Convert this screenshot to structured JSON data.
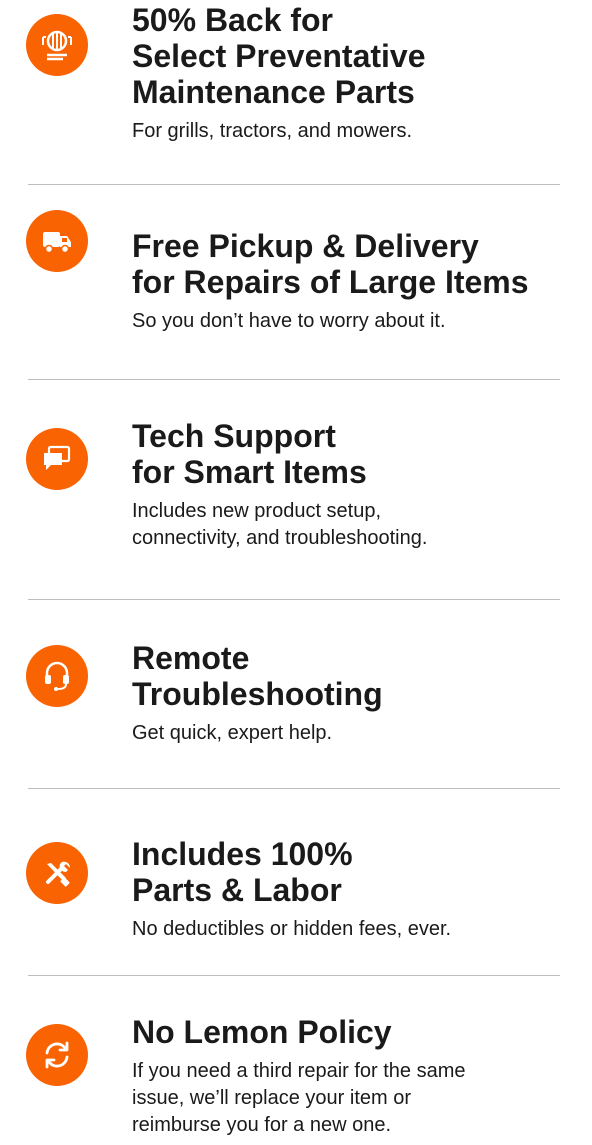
{
  "accent_color": "#f96302",
  "benefits": [
    {
      "icon": "grill-parts-icon",
      "title_lines": [
        "50% Back for",
        "Select Preventative",
        "Maintenance Parts"
      ],
      "desc_lines": [
        "For grills, tractors, and mowers."
      ]
    },
    {
      "icon": "delivery-truck-icon",
      "title_lines": [
        "Free Pickup & Delivery",
        "for Repairs of Large Items"
      ],
      "desc_lines": [
        "So you don’t have to worry about it."
      ]
    },
    {
      "icon": "chat-bubbles-icon",
      "title_lines": [
        "Tech Support",
        "for Smart Items"
      ],
      "desc_lines": [
        "Includes new product setup,",
        "connectivity, and troubleshooting."
      ]
    },
    {
      "icon": "headset-icon",
      "title_lines": [
        "Remote",
        "Troubleshooting"
      ],
      "desc_lines": [
        "Get quick, expert help."
      ]
    },
    {
      "icon": "tools-icon",
      "title_lines": [
        "Includes 100%",
        "Parts & Labor"
      ],
      "desc_lines": [
        "No deductibles or hidden fees, ever."
      ]
    },
    {
      "icon": "refresh-icon",
      "title_lines": [
        "No Lemon Policy"
      ],
      "desc_lines": [
        "If you need a third repair for the same",
        "issue, we’ll replace your item or",
        "reimburse you for a new one."
      ]
    }
  ]
}
